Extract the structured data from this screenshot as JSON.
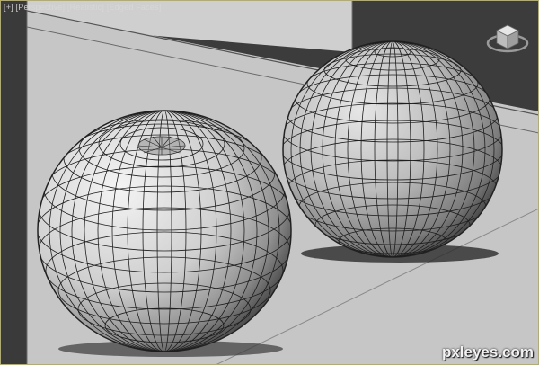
{
  "viewport": {
    "bracket_plus": "[+]",
    "view_name": "[Perspective]",
    "shading_mode": "[Realistic]",
    "edge_mode": "[Edged Faces]"
  },
  "viewcube": {
    "icon": "viewcube-icon"
  },
  "scene": {
    "objects": [
      {
        "name": "sphere",
        "style": "geosphere-wireframe"
      },
      {
        "name": "sphere",
        "style": "geosphere-wireframe"
      }
    ]
  },
  "watermark": {
    "text": "pxleyes.com"
  },
  "colors": {
    "frame": "#b9b04a",
    "floor": "#c8c8c8",
    "background": "#3a3a3a"
  }
}
